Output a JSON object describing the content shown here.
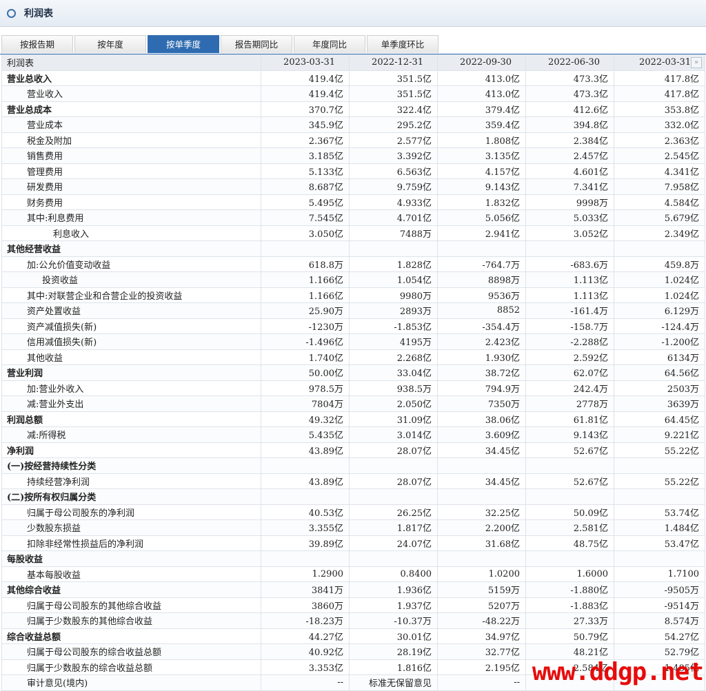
{
  "title": "利润表",
  "tabs": [
    "按报告期",
    "按年度",
    "按单季度",
    "报告期同比",
    "年度同比",
    "单季度环比"
  ],
  "active_tab": 2,
  "table": {
    "header": [
      "利润表",
      "2023-03-31",
      "2022-12-31",
      "2022-09-30",
      "2022-06-30",
      "2022-03-31"
    ],
    "rows": [
      {
        "label": "营业总收入",
        "style": "b",
        "values": [
          "419.4亿",
          "351.5亿",
          "413.0亿",
          "473.3亿",
          "417.8亿"
        ]
      },
      {
        "label": "营业收入",
        "style": "i1",
        "values": [
          "419.4亿",
          "351.5亿",
          "413.0亿",
          "473.3亿",
          "417.8亿"
        ]
      },
      {
        "label": "营业总成本",
        "style": "b",
        "values": [
          "370.7亿",
          "322.4亿",
          "379.4亿",
          "412.6亿",
          "353.8亿"
        ]
      },
      {
        "label": "营业成本",
        "style": "i1",
        "values": [
          "345.9亿",
          "295.2亿",
          "359.4亿",
          "394.8亿",
          "332.0亿"
        ]
      },
      {
        "label": "税金及附加",
        "style": "i1",
        "values": [
          "2.367亿",
          "2.577亿",
          "1.808亿",
          "2.384亿",
          "2.363亿"
        ]
      },
      {
        "label": "销售费用",
        "style": "i1",
        "values": [
          "3.185亿",
          "3.392亿",
          "3.135亿",
          "2.457亿",
          "2.545亿"
        ]
      },
      {
        "label": "管理费用",
        "style": "i1",
        "values": [
          "5.133亿",
          "6.563亿",
          "4.157亿",
          "4.601亿",
          "4.341亿"
        ]
      },
      {
        "label": "研发费用",
        "style": "i1",
        "values": [
          "8.687亿",
          "9.759亿",
          "9.143亿",
          "7.341亿",
          "7.958亿"
        ]
      },
      {
        "label": "财务费用",
        "style": "i1",
        "values": [
          "5.495亿",
          "4.933亿",
          "1.832亿",
          "9998万",
          "4.584亿"
        ]
      },
      {
        "label": "其中:利息费用",
        "style": "i1",
        "values": [
          "7.545亿",
          "4.701亿",
          "5.056亿",
          "5.033亿",
          "5.679亿"
        ]
      },
      {
        "label": "利息收入",
        "style": "i2",
        "values": [
          "3.050亿",
          "7488万",
          "2.941亿",
          "3.052亿",
          "2.349亿"
        ]
      },
      {
        "label": "其他经营收益",
        "style": "b",
        "values": [
          "",
          "",
          "",
          "",
          ""
        ]
      },
      {
        "label": "加:公允价值变动收益",
        "style": "i1",
        "values": [
          "618.8万",
          "1.828亿",
          "-764.7万",
          "-683.6万",
          "459.8万"
        ]
      },
      {
        "label": "投资收益",
        "style": "i3",
        "values": [
          "1.166亿",
          "1.054亿",
          "8898万",
          "1.113亿",
          "1.024亿"
        ]
      },
      {
        "label": "其中:对联营企业和合营企业的投资收益",
        "style": "i1",
        "values": [
          "1.166亿",
          "9980万",
          "9536万",
          "1.113亿",
          "1.024亿"
        ]
      },
      {
        "label": "资产处置收益",
        "style": "i1",
        "values": [
          "25.90万",
          "2893万",
          "8852",
          "-161.4万",
          "6.129万"
        ]
      },
      {
        "label": "资产减值损失(新)",
        "style": "i1",
        "values": [
          "-1230万",
          "-1.853亿",
          "-354.4万",
          "-158.7万",
          "-124.4万"
        ]
      },
      {
        "label": "信用减值损失(新)",
        "style": "i1",
        "values": [
          "-1.496亿",
          "4195万",
          "2.423亿",
          "-2.288亿",
          "-1.200亿"
        ]
      },
      {
        "label": "其他收益",
        "style": "i1",
        "values": [
          "1.740亿",
          "2.268亿",
          "1.930亿",
          "2.592亿",
          "6134万"
        ]
      },
      {
        "label": "营业利润",
        "style": "b",
        "values": [
          "50.00亿",
          "33.04亿",
          "38.72亿",
          "62.07亿",
          "64.56亿"
        ]
      },
      {
        "label": "加:营业外收入",
        "style": "i1",
        "values": [
          "978.5万",
          "938.5万",
          "794.9万",
          "242.4万",
          "2503万"
        ]
      },
      {
        "label": "减:营业外支出",
        "style": "i1",
        "values": [
          "7804万",
          "2.050亿",
          "7350万",
          "2778万",
          "3639万"
        ]
      },
      {
        "label": "利润总额",
        "style": "b",
        "values": [
          "49.32亿",
          "31.09亿",
          "38.06亿",
          "61.81亿",
          "64.45亿"
        ]
      },
      {
        "label": "减:所得税",
        "style": "i1",
        "values": [
          "5.435亿",
          "3.014亿",
          "3.609亿",
          "9.143亿",
          "9.221亿"
        ]
      },
      {
        "label": "净利润",
        "style": "b",
        "values": [
          "43.89亿",
          "28.07亿",
          "34.45亿",
          "52.67亿",
          "55.22亿"
        ]
      },
      {
        "label": "(一)按经营持续性分类",
        "style": "b",
        "values": [
          "",
          "",
          "",
          "",
          ""
        ]
      },
      {
        "label": "持续经营净利润",
        "style": "i1",
        "values": [
          "43.89亿",
          "28.07亿",
          "34.45亿",
          "52.67亿",
          "55.22亿"
        ]
      },
      {
        "label": "(二)按所有权归属分类",
        "style": "b",
        "values": [
          "",
          "",
          "",
          "",
          ""
        ]
      },
      {
        "label": "归属于母公司股东的净利润",
        "style": "i1",
        "values": [
          "40.53亿",
          "26.25亿",
          "32.25亿",
          "50.09亿",
          "53.74亿"
        ]
      },
      {
        "label": "少数股东损益",
        "style": "i1",
        "values": [
          "3.355亿",
          "1.817亿",
          "2.200亿",
          "2.581亿",
          "1.484亿"
        ]
      },
      {
        "label": "扣除非经常性损益后的净利润",
        "style": "i1",
        "values": [
          "39.89亿",
          "24.07亿",
          "31.68亿",
          "48.75亿",
          "53.47亿"
        ]
      },
      {
        "label": "每股收益",
        "style": "b",
        "values": [
          "",
          "",
          "",
          "",
          ""
        ]
      },
      {
        "label": "基本每股收益",
        "style": "i1",
        "values": [
          "1.2900",
          "0.8400",
          "1.0200",
          "1.6000",
          "1.7100"
        ]
      },
      {
        "label": "其他综合收益",
        "style": "b",
        "values": [
          "3841万",
          "1.936亿",
          "5159万",
          "-1.880亿",
          "-9505万"
        ]
      },
      {
        "label": "归属于母公司股东的其他综合收益",
        "style": "i1",
        "values": [
          "3860万",
          "1.937亿",
          "5207万",
          "-1.883亿",
          "-9514万"
        ]
      },
      {
        "label": "归属于少数股东的其他综合收益",
        "style": "i1",
        "values": [
          "-18.23万",
          "-10.37万",
          "-48.22万",
          "27.33万",
          "8.574万"
        ]
      },
      {
        "label": "综合收益总额",
        "style": "b",
        "values": [
          "44.27亿",
          "30.01亿",
          "34.97亿",
          "50.79亿",
          "54.27亿"
        ]
      },
      {
        "label": "归属于母公司股东的综合收益总额",
        "style": "i1",
        "values": [
          "40.92亿",
          "28.19亿",
          "32.77亿",
          "48.21亿",
          "52.79亿"
        ]
      },
      {
        "label": "归属于少数股东的综合收益总额",
        "style": "i1",
        "values": [
          "3.353亿",
          "1.816亿",
          "2.195亿",
          "2.584亿",
          "1.485亿"
        ]
      },
      {
        "label": "审计意见(境内)",
        "style": "i1",
        "values": [
          "--",
          "标准无保留意见",
          "--",
          "",
          ""
        ]
      }
    ]
  },
  "nav_icon": "»",
  "watermark": "www.ddgp.net"
}
